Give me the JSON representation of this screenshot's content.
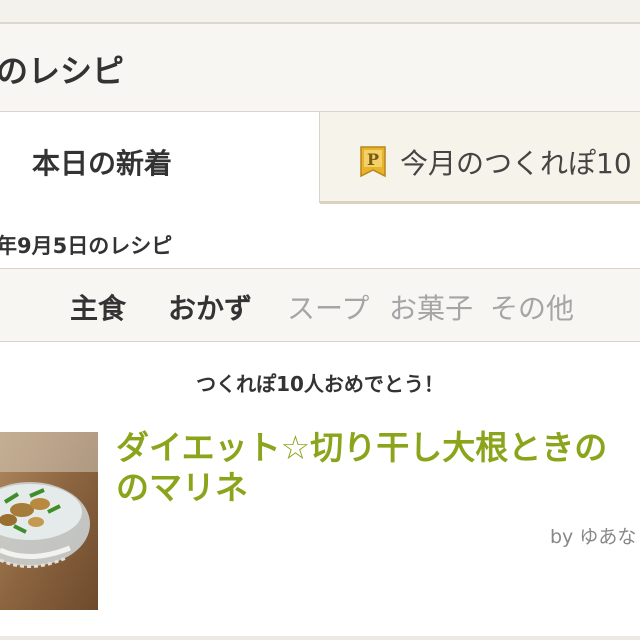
{
  "header": {
    "title": "のレシピ"
  },
  "tabs": {
    "today": {
      "label": "本日の新着"
    },
    "month": {
      "label": "今月のつくれぽ10",
      "badge_letter": "P",
      "badge_color": "#e8b52a"
    }
  },
  "date_label": "年9月5日のレシピ",
  "categories": [
    {
      "label": "主食",
      "active": true
    },
    {
      "label": "おかず",
      "active": true
    },
    {
      "label": "スープ",
      "active": false
    },
    {
      "label": "お菓子",
      "active": false
    },
    {
      "label": "その他",
      "active": false
    }
  ],
  "congrats": "つくれぽ10人おめでとう！",
  "recipe": {
    "title_line1": "ダイエット☆切り干し大根ときの",
    "title_line2": "のマリネ",
    "author": "by ゆあな",
    "title_color": "#8aa51b"
  }
}
